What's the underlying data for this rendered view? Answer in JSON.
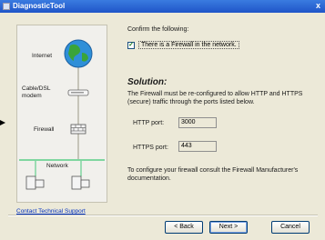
{
  "window": {
    "title": "DiagnosticTool",
    "close_glyph": "x"
  },
  "diagram": {
    "internet_label": "Internet",
    "modem_label": "Cable/DSL\nmodem",
    "firewall_label": "Firewall",
    "network_label": "Network"
  },
  "contact_link": "Contact Technical Support",
  "content": {
    "confirm_text": "Confirm the following:",
    "checkbox_label": "There is a Firewall in the network.",
    "checkbox_checked": true,
    "solution_title": "Solution:",
    "solution_text": "The Firewall must be re-configured to allow HTTP and HTTPS (secure) traffic through the ports listed below.",
    "http_label": "HTTP port:",
    "http_value": "3000",
    "https_label": "HTTPS port:",
    "https_value": "443",
    "footer_text": "To configure your firewall consult the Firewall Manufacturer's documentation."
  },
  "buttons": {
    "back": "< Back",
    "next": "Next >",
    "cancel": "Cancel"
  },
  "colors": {
    "title_bar": "#2a66d6",
    "globe": "#2f8fd8",
    "network_line": "#7fd6a0",
    "link": "#0030c0"
  }
}
